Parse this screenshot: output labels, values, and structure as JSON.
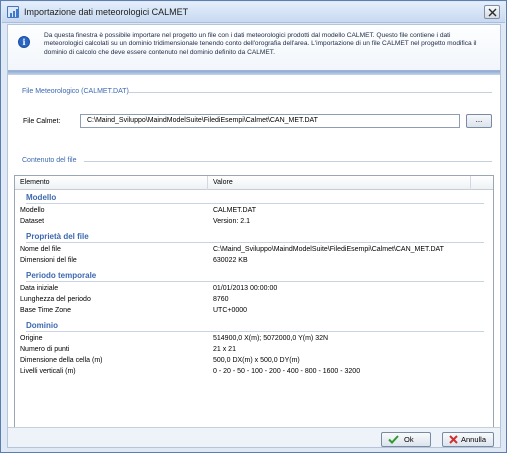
{
  "window": {
    "title": "Importazione dati meteorologici CALMET",
    "icon": "calmet-window-icon",
    "close_icon": "close-icon"
  },
  "info": {
    "icon": "info-icon",
    "text": "Da questa finestra è possibile importare nel progetto un file con i dati meteorologici prodotti dal modello CALMET. Questo file contiene i dati meteorologici calcolati su un dominio tridimensionale tenendo conto dell'orografia dell'area. L'importazione di un file CALMET nel progetto modifica il dominio di calcolo che deve essere contenuto nel dominio definito da CALMET."
  },
  "file_section": {
    "title": "File Meteorologico (CALMET.DAT)",
    "field_label": "File Calmet:",
    "field_value": "C:\\Maind_Sviluppo\\MaindModelSuite\\FilediEsempi\\Calmet\\CAN_MET.DAT",
    "browse_label": "..."
  },
  "contents_section": {
    "title": "Contenuto del file",
    "columns": [
      "Elemento",
      "Valore"
    ],
    "groups": [
      {
        "title": "Modello",
        "rows": [
          {
            "key": "Modello",
            "value": "CALMET.DAT"
          },
          {
            "key": "Dataset",
            "value": "Version: 2.1"
          }
        ]
      },
      {
        "title": "Proprietà del file",
        "rows": [
          {
            "key": "Nome del file",
            "value": "C:\\Maind_Sviluppo\\MaindModelSuite\\FilediEsempi\\Calmet\\CAN_MET.DAT"
          },
          {
            "key": "Dimensioni del file",
            "value": "630022 KB"
          }
        ]
      },
      {
        "title": "Periodo temporale",
        "rows": [
          {
            "key": "Data iniziale",
            "value": "01/01/2013 00:00:00"
          },
          {
            "key": "Lunghezza del periodo",
            "value": "8760"
          },
          {
            "key": "Base Time Zone",
            "value": "UTC+0000"
          }
        ]
      },
      {
        "title": "Dominio",
        "rows": [
          {
            "key": "Origine",
            "value": "514900,0 X(m); 5072000,0 Y(m) 32N"
          },
          {
            "key": "Numero di punti",
            "value": "21 x 21"
          },
          {
            "key": "Dimensione della cella (m)",
            "value": "500,0 DX(m) x 500,0 DY(m)"
          },
          {
            "key": "Livelli verticali (m)",
            "value": "0 - 20 - 50 - 100 - 200 - 400 - 800 - 1600 - 3200"
          }
        ]
      }
    ]
  },
  "footer": {
    "ok_label": "Ok",
    "ok_icon": "checkmark-icon",
    "cancel_label": "Annulla",
    "cancel_icon": "cancel-x-icon"
  },
  "colors": {
    "section_title": "#3c68b0",
    "window_border": "#5b7db1",
    "ok_icon": "#2e9a2e",
    "cancel_icon": "#d03030"
  }
}
